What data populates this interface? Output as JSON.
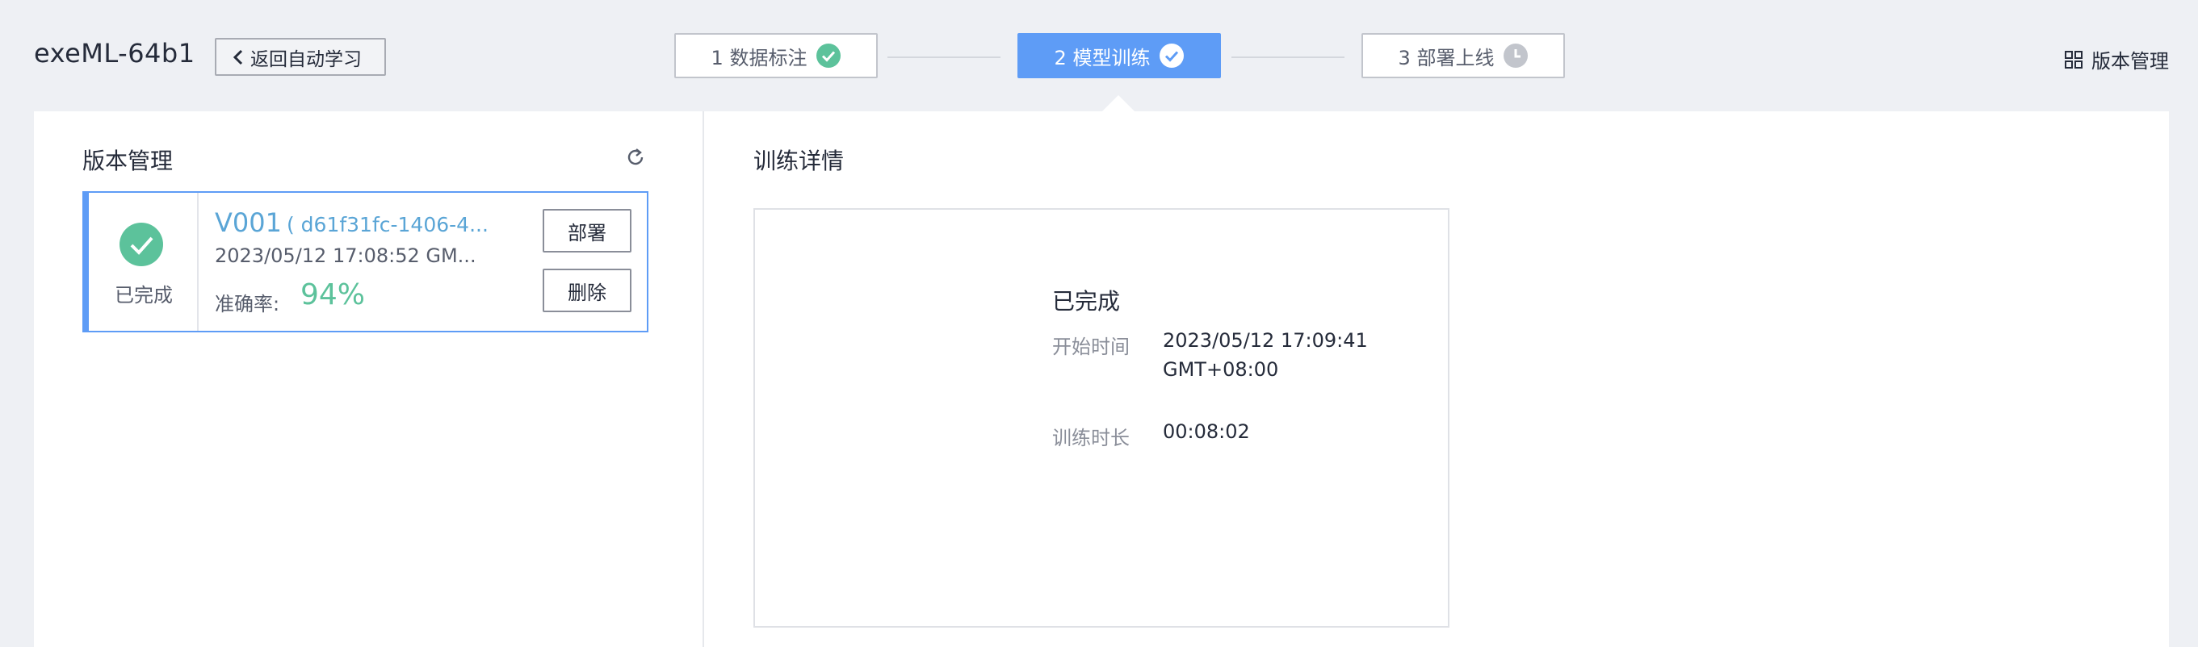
{
  "header": {
    "app_title": "exeML-64b1",
    "back_label": "返回自动学习",
    "right_link_label": "版本管理"
  },
  "steps": [
    {
      "label": "1 数据标注",
      "state": "done"
    },
    {
      "label": "2 模型训练",
      "state": "active-done"
    },
    {
      "label": "3 部署上线",
      "state": "pending"
    }
  ],
  "left_panel": {
    "title": "版本管理",
    "card": {
      "status": "已完成",
      "version": "V001",
      "version_id": "( d61f31fc-1406-4...",
      "time": "2023/05/12 17:08:52 GM...",
      "accuracy_label": "准确率:",
      "accuracy_value": "94%",
      "deploy_label": "部署",
      "delete_label": "删除"
    }
  },
  "right_panel": {
    "title": "训练详情",
    "status": "已完成",
    "start_label": "开始时间",
    "start_value_line1": "2023/05/12 17:09:41",
    "start_value_line2": "GMT+08:00",
    "duration_label": "训练时长",
    "duration_value": "00:08:02"
  },
  "colors": {
    "accent": "#5e9cf6",
    "success": "#5cc29b",
    "link": "#5aa5d6",
    "background": "#eef0f4"
  },
  "icons": {
    "back": "chevron-left-icon",
    "step_done": "check-circle-icon",
    "step_pending": "clock-icon",
    "version_mgmt": "grid-icon",
    "refresh": "refresh-icon",
    "card_status": "check-circle-icon"
  }
}
